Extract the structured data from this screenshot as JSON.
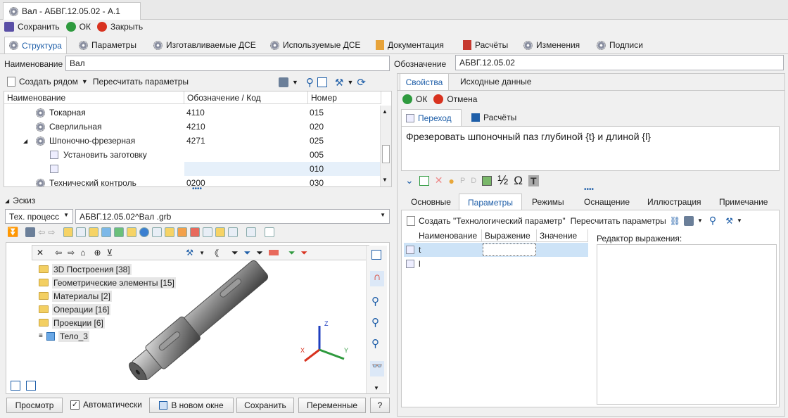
{
  "window_tab": "Вал - АБВГ.12.05.02 - А.1",
  "toolbar": {
    "save": "Сохранить",
    "ok": "ОК",
    "close": "Закрыть"
  },
  "main_tabs": [
    "Структура",
    "Параметры",
    "Изготавливаемые ДСЕ",
    "Используемые ДСЕ",
    "Документация",
    "Расчёты",
    "Изменения",
    "Подписи"
  ],
  "name_label": "Наименование",
  "name_value": "Вал",
  "designation_label": "Обозначение",
  "designation_value": "АБВГ.12.05.02",
  "struct_toolbar": {
    "create_near": "Создать рядом",
    "recalc": "Пересчитать параметры"
  },
  "grid": {
    "columns": [
      "Наименование",
      "Обозначение / Код",
      "Номер"
    ],
    "rows": [
      {
        "name": "Токарная",
        "code": "4110",
        "number": "015"
      },
      {
        "name": "Сверлильная",
        "code": "4210",
        "number": "020"
      },
      {
        "name": "Шпоночно-фрезерная",
        "code": "4271",
        "number": "025"
      },
      {
        "name": "Установить заготовку",
        "code": "",
        "number": "005"
      },
      {
        "name": "",
        "code": "",
        "number": "010"
      },
      {
        "name": "Технический контроль",
        "code": "0200",
        "number": "030"
      }
    ]
  },
  "sketch": {
    "title": "Эскиз",
    "process_select": "Тех. процесс",
    "file_select": "АБВГ.12.05.02^Вал .grb",
    "tree": [
      "3D Построения [38]",
      "Геометрические элементы [15]",
      "Материалы [2]",
      "Операции [16]",
      "Проекции [6]",
      "Тело_3"
    ],
    "axes": {
      "x": "X",
      "y": "Y",
      "z": "Z"
    }
  },
  "bottom_bar": {
    "preview": "Просмотр",
    "auto": "Автоматически",
    "new_window": "В новом окне",
    "save": "Сохранить",
    "variables": "Переменные",
    "help": "?"
  },
  "right": {
    "tabs": [
      "Свойства",
      "Исходные данные"
    ],
    "ok": "ОК",
    "cancel": "Отмена",
    "subtabs": [
      "Переход",
      "Расчёты"
    ],
    "transition_text": "Фрезеровать шпоночный паз глубиной {t} и длиной {l}",
    "format_half": "½",
    "format_omega": "Ω",
    "format_t": "T",
    "format_p": "P",
    "format_d": "D",
    "param_tabs": [
      "Основные",
      "Параметры",
      "Режимы",
      "Оснащение",
      "Иллюстрация",
      "Примечание"
    ],
    "param_toolbar": {
      "create": "Создать \"Технологический параметр\"",
      "recalc": "Пересчитать параметры"
    },
    "param_columns": [
      "Наименование",
      "Выражение",
      "Значение"
    ],
    "param_rows": [
      {
        "name": "t"
      },
      {
        "name": "l"
      }
    ],
    "expr_editor_label": "Редактор выражения:"
  },
  "colors": {
    "accent": "#1e5ea8",
    "selection": "#cde3f7",
    "ok_green": "#2e9a3e",
    "cancel_red": "#d8321f"
  }
}
